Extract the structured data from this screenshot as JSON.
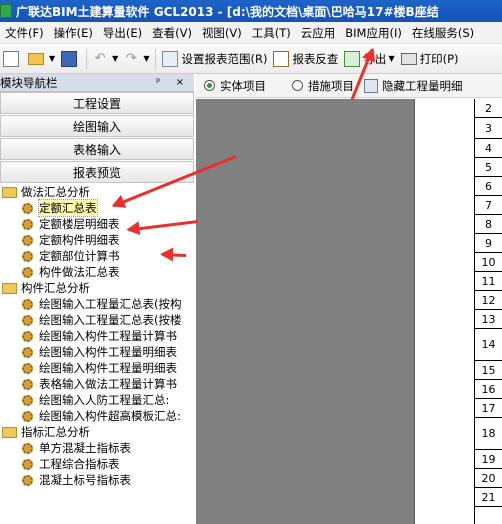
{
  "window": {
    "title": "广联达BIM土建算量软件 GCL2013 - [d:\\我的文档\\桌面\\巴哈马17#楼B座结"
  },
  "menu": [
    "文件(F)",
    "操作(E)",
    "导出(E)",
    "查看(V)",
    "视图(V)",
    "工具(T)",
    "云应用",
    "BIM应用(I)",
    "在线服务(S)"
  ],
  "toolbar": {
    "set_range": "设置报表范围(R)",
    "reverse_check": "报表反查",
    "export": "导出",
    "print": "打印(P)",
    "undo_glyph": "↶",
    "redo_glyph": "↷"
  },
  "nav": {
    "header": "模块导航栏",
    "header_pins": "ᵖ ×",
    "buttons": [
      "工程设置",
      "绘图输入",
      "表格输入",
      "报表预览"
    ],
    "tree": [
      {
        "type": "folder",
        "label": "做法汇总分析"
      },
      {
        "type": "leaf",
        "label": "定额汇总表",
        "selected": true
      },
      {
        "type": "leaf",
        "label": "定额楼层明细表"
      },
      {
        "type": "leaf",
        "label": "定额构件明细表"
      },
      {
        "type": "leaf",
        "label": "定额部位计算书"
      },
      {
        "type": "leaf",
        "label": "构件做法汇总表"
      },
      {
        "type": "folder",
        "label": "构件汇总分析"
      },
      {
        "type": "leaf",
        "label": "绘图输入工程量汇总表(按构"
      },
      {
        "type": "leaf",
        "label": "绘图输入工程量汇总表(按楼"
      },
      {
        "type": "leaf",
        "label": "绘图输入构件工程量计算书"
      },
      {
        "type": "leaf",
        "label": "绘图输入构件工程量明细表"
      },
      {
        "type": "leaf",
        "label": "绘图输入构件工程量明细表"
      },
      {
        "type": "leaf",
        "label": "表格输入做法工程量计算书"
      },
      {
        "type": "leaf",
        "label": "绘图输入人防工程量汇总:"
      },
      {
        "type": "leaf",
        "label": "绘图输入构件超高模板汇总:"
      },
      {
        "type": "folder",
        "label": "指标汇总分析"
      },
      {
        "type": "leaf",
        "label": "单方混凝土指标表"
      },
      {
        "type": "leaf",
        "label": "工程综合指标表"
      },
      {
        "type": "leaf",
        "label": "混凝土标号指标表"
      }
    ]
  },
  "report_tabs": {
    "option_entity": "实体项目",
    "option_measure": "措施项目",
    "hide_zero": "隐藏工程量明细"
  },
  "row_numbers": [
    "2",
    "3",
    "4",
    "5",
    "6",
    "7",
    "8",
    "9",
    "10",
    "11",
    "12",
    "13",
    "14",
    "15",
    "16",
    "17",
    "18",
    "19",
    "20",
    "21"
  ],
  "colors": {
    "title_bar": "#1553b4",
    "annotation_arrow": "#e8302c",
    "preview_gray": "#808080"
  }
}
